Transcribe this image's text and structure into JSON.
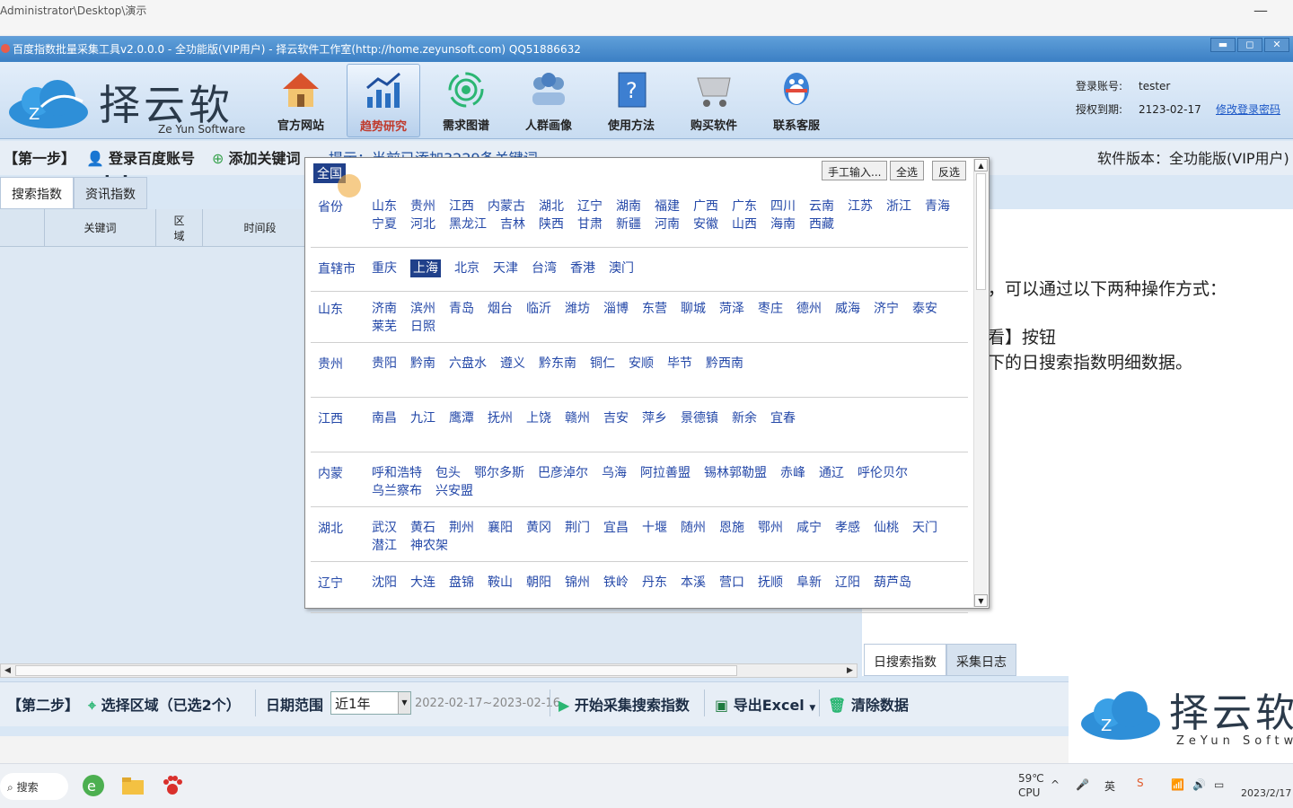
{
  "explorer": {
    "path": "Administrator\\Desktop\\演示",
    "minimize": "—"
  },
  "window": {
    "title": "百度指数批量采集工具v2.0.0.0 - 全功能版(VIP用户) - 择云软件工作室(http://home.zeyunsoft.com) QQ51886632",
    "buttons": [
      "▬",
      "◻",
      "✕"
    ]
  },
  "brand": {
    "name": "择云软件",
    "sub": "Ze Yun Software"
  },
  "nav": [
    {
      "label": "官方网站",
      "icon": "home-icon"
    },
    {
      "label": "趋势研究",
      "icon": "chart-icon"
    },
    {
      "label": "需求图谱",
      "icon": "signal-icon"
    },
    {
      "label": "人群画像",
      "icon": "people-icon"
    },
    {
      "label": "使用方法",
      "icon": "help-book-icon"
    },
    {
      "label": "购买软件",
      "icon": "cart-icon"
    },
    {
      "label": "联系客服",
      "icon": "qq-penguin-icon"
    }
  ],
  "account": {
    "login_label": "登录账号:",
    "login_value": "tester",
    "expire_label": "授权到期:",
    "expire_value": "2123-02-17",
    "change_password": "修改登录密码"
  },
  "step1": {
    "label": "【第一步】",
    "login_baidu": "登录百度账号",
    "add_keyword": "添加关键词",
    "hint": "提示：当前已添加3229条关键词",
    "version": "软件版本：全功能版(VIP用户)"
  },
  "left_tabs": [
    "搜索指数",
    "资讯指数"
  ],
  "grid_columns": [
    "",
    "关键词",
    "区\n域",
    "时间段"
  ],
  "right_panel": {
    "line1": "，可以通过以下两种操作方式：",
    "line2": "看】按钮",
    "line3": "下的日搜索指数明细数据。"
  },
  "right_tabs": [
    "日搜索指数",
    "采集日志"
  ],
  "step2": {
    "label": "【第二步】",
    "select_region": "选择区域（已选2个）",
    "date_range_label": "日期范围",
    "date_option": "近1年",
    "date_range": "2022-02-17~2023-02-16",
    "start": "开始采集搜索指数",
    "export": "导出Excel",
    "clear": "清除数据"
  },
  "watermark": {
    "name": "择云软件",
    "sub": "ZeYun Software"
  },
  "region_popup": {
    "all": "全国",
    "buttons": [
      "手工输入...",
      "全选",
      "反选"
    ],
    "groups": [
      {
        "name": "省份",
        "cities": [
          "山东",
          "贵州",
          "江西",
          "内蒙古",
          "湖北",
          "辽宁",
          "湖南",
          "福建",
          "广西",
          "广东",
          "四川",
          "云南",
          "江苏",
          "浙江",
          "青海",
          "宁夏",
          "河北",
          "黑龙江",
          "吉林",
          "陕西",
          "甘肃",
          "新疆",
          "河南",
          "安徽",
          "山西",
          "海南",
          "西藏"
        ]
      },
      {
        "name": "直辖市",
        "cities": [
          "重庆",
          "上海",
          "北京",
          "天津",
          "台湾",
          "香港",
          "澳门"
        ]
      },
      {
        "name": "山东",
        "cities": [
          "济南",
          "滨州",
          "青岛",
          "烟台",
          "临沂",
          "潍坊",
          "淄博",
          "东营",
          "聊城",
          "菏泽",
          "枣庄",
          "德州",
          "威海",
          "济宁",
          "泰安",
          "莱芜",
          "日照"
        ]
      },
      {
        "name": "贵州",
        "cities": [
          "贵阳",
          "黔南",
          "六盘水",
          "遵义",
          "黔东南",
          "铜仁",
          "安顺",
          "毕节",
          "黔西南"
        ]
      },
      {
        "name": "江西",
        "cities": [
          "南昌",
          "九江",
          "鹰潭",
          "抚州",
          "上饶",
          "赣州",
          "吉安",
          "萍乡",
          "景德镇",
          "新余",
          "宜春"
        ]
      },
      {
        "name": "内蒙",
        "cities": [
          "呼和浩特",
          "包头",
          "鄂尔多斯",
          "巴彦淖尔",
          "乌海",
          "阿拉善盟",
          "锡林郭勒盟",
          "赤峰",
          "通辽",
          "呼伦贝尔",
          "乌兰察布",
          "兴安盟"
        ]
      },
      {
        "name": "湖北",
        "cities": [
          "武汉",
          "黄石",
          "荆州",
          "襄阳",
          "黄冈",
          "荆门",
          "宜昌",
          "十堰",
          "随州",
          "恩施",
          "鄂州",
          "咸宁",
          "孝感",
          "仙桃",
          "天门",
          "潜江",
          "神农架"
        ]
      },
      {
        "name": "辽宁",
        "cities": [
          "沈阳",
          "大连",
          "盘锦",
          "鞍山",
          "朝阳",
          "锦州",
          "铁岭",
          "丹东",
          "本溪",
          "营口",
          "抚顺",
          "阜新",
          "辽阳",
          "葫芦岛"
        ]
      }
    ],
    "selected_city": "上海"
  },
  "taskbar": {
    "search": "搜索",
    "temp": "59℃",
    "cpu": "CPU",
    "lang": "英",
    "date": "2023/2/17"
  }
}
